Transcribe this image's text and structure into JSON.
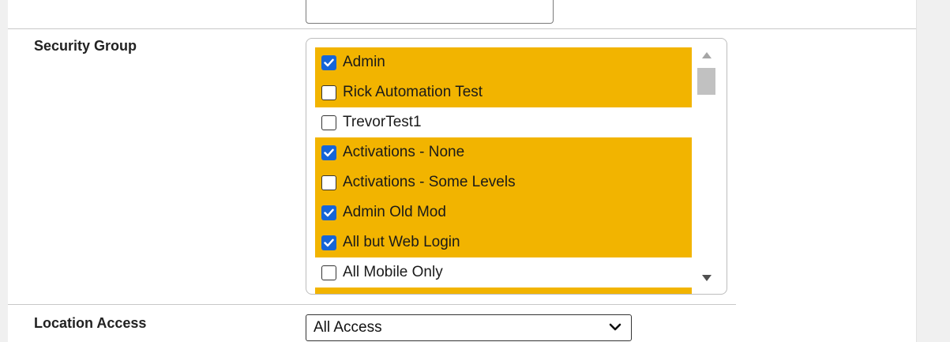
{
  "security_group": {
    "label": "Security Group",
    "items": [
      {
        "label": "Admin",
        "checked": true,
        "highlighted": true
      },
      {
        "label": "Rick Automation Test",
        "checked": false,
        "highlighted": true
      },
      {
        "label": "TrevorTest1",
        "checked": false,
        "highlighted": false
      },
      {
        "label": "Activations - None",
        "checked": true,
        "highlighted": true
      },
      {
        "label": "Activations - Some Levels",
        "checked": false,
        "highlighted": true
      },
      {
        "label": "Admin Old Mod",
        "checked": true,
        "highlighted": true
      },
      {
        "label": "All but Web Login",
        "checked": true,
        "highlighted": true
      },
      {
        "label": "All Mobile Only",
        "checked": false,
        "highlighted": false
      },
      {
        "label": "",
        "checked": false,
        "highlighted": true
      }
    ]
  },
  "location_access": {
    "label": "Location Access",
    "selected": "All Access"
  },
  "colors": {
    "highlight": "#f2b400",
    "checkbox_checked": "#1565d8"
  }
}
